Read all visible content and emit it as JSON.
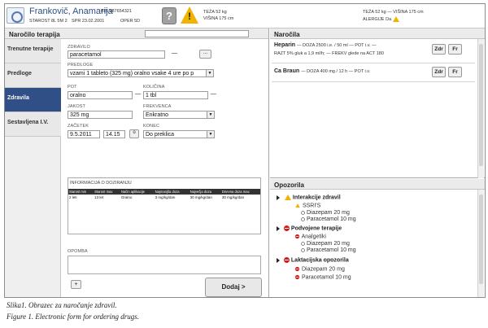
{
  "header": {
    "patient_name": "Frankovič, Anamarija",
    "bis": "BIS 987654321",
    "age": "STAROST 8L 5M 2",
    "spr": "SPR 23.02.2001",
    "oper": "OPER 5D",
    "weight": "TEŽA 52 kg",
    "height": "VIŠINA 175 cm",
    "right_weight": "TEŽA 52 kg — VIŠINA 175 cm",
    "allergy": "ALERGIJE Da",
    "help_icon": "?",
    "warning_icon": "!"
  },
  "left": {
    "title": "Naročilo terapija",
    "tabs": [
      {
        "label": "Trenutne terapije"
      },
      {
        "label": "Predloge"
      },
      {
        "label": "Zdravila"
      },
      {
        "label": "Sestavljena I.V."
      }
    ],
    "form": {
      "drug_label": "ZDRAVILO",
      "drug_value": "paracetamol",
      "drug_dash": "—",
      "drug_btn": "...",
      "template_label": "PREDLOGE",
      "template_value": "vzami 1 tableto (325 mg) oralno vsake 4 ure po p",
      "route_label": "POT",
      "route_value": "oralno",
      "qty_label": "KOLIČINA",
      "qty_value": "1 tbl",
      "strength_label": "JAKOST",
      "strength_value": "325 mg",
      "freq_label": "FREKVENCA",
      "freq_value": "Enkratno",
      "start_label": "ZAČETEK",
      "start_date": "9.5.2011",
      "start_time": "14.15",
      "start_btn": "o",
      "end_label": "KONEC",
      "end_value": "Do preklica",
      "dosing_title": "INFORMACIJA O DOZIRANJU",
      "dosing_headers": [
        "Starost min",
        "Starost max",
        "Način aplikacije",
        "Najmanjša doza",
        "Največja doza",
        "Dnevna doza max"
      ],
      "dosing_row": [
        "2 leti",
        "13 let",
        "Oralno",
        "3 mg/kg/dan",
        "30 mg/kg/dan",
        "30 mg/kg/dan"
      ],
      "note_label": "OPOMBA",
      "add_btn": "+",
      "submit_btn": "Dodaj >"
    }
  },
  "right": {
    "orders_title": "Naročila",
    "orders": [
      {
        "drug": "Heparin",
        "line1": "— DOZA 2500 i.e. / 50 ml — POT i.v. —",
        "line2": "RAZT 5% gluk a 1,9 ml/h; — FREKV glede na ACT 180",
        "btn1": "Zdr",
        "btn2": "Fr"
      },
      {
        "drug": "Ca Braun",
        "line1": "— DOZA 400 mg / 12 h — POT i.v.",
        "btn1": "Zdr",
        "btn2": "Fr"
      }
    ],
    "warnings_title": "Opozorila",
    "warnings": [
      {
        "title": "Interakcije zdravil",
        "icon": "warning-icon",
        "sub": "SSRI'S",
        "items": [
          "Diazepam 20 mg",
          "Paracetamol 10 mg"
        ]
      },
      {
        "title": "Podvojene terapije",
        "icon": "no-entry-icon",
        "sub": "Analgetiki",
        "items": [
          "Diazepam 20 mg",
          "Paracetamol 10 mg"
        ]
      },
      {
        "title": "Laktacijska opozorila",
        "icon": "no-entry-icon",
        "items": [
          "Diazepam 20 mg",
          "Paracetamol 10 mg"
        ]
      }
    ]
  },
  "captions": [
    "Slika1. Obrazec za naročanje zdravil.",
    "Figure 1. Electronic form for ordering drugs."
  ]
}
